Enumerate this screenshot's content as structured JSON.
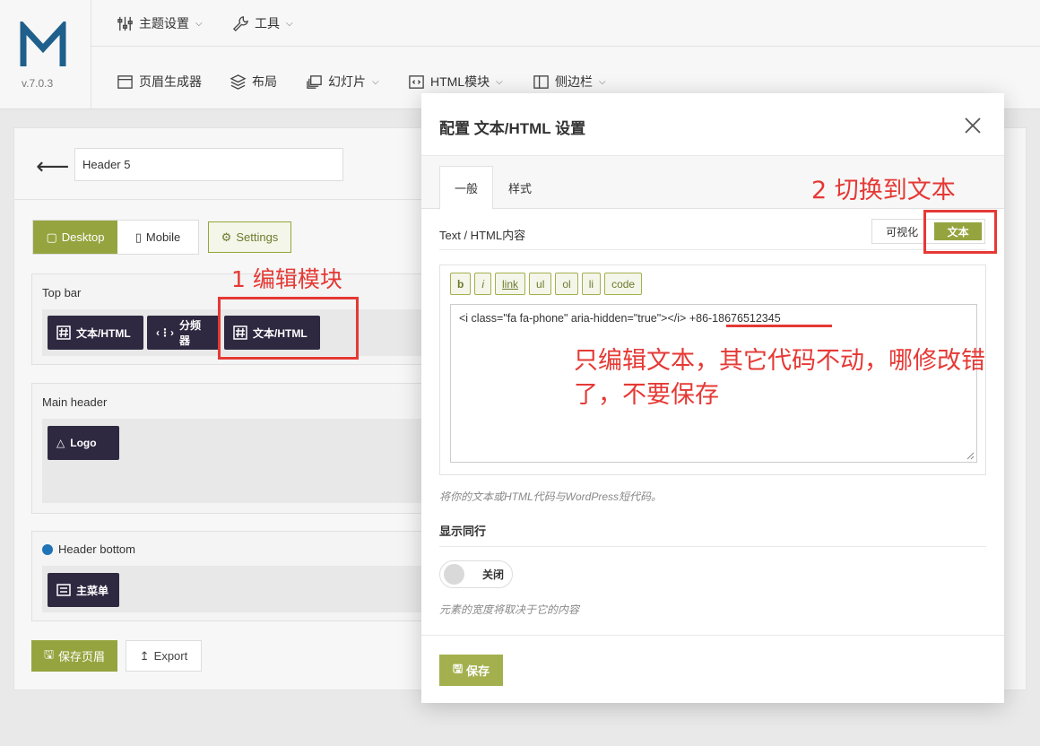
{
  "app": {
    "version": "v.7.0.3",
    "logo_letter": "M"
  },
  "nav": {
    "row1": [
      {
        "label": "主题设置",
        "icon": "sliders-icon",
        "has_dropdown": true
      },
      {
        "label": "工具",
        "icon": "wrench-icon",
        "has_dropdown": true
      }
    ],
    "row2": [
      {
        "label": "页眉生成器",
        "icon": "window-icon",
        "has_dropdown": false
      },
      {
        "label": "布局",
        "icon": "layers-icon",
        "has_dropdown": false
      },
      {
        "label": "幻灯片",
        "icon": "slides-icon",
        "has_dropdown": true
      },
      {
        "label": "HTML模块",
        "icon": "code-icon",
        "has_dropdown": true
      },
      {
        "label": "侧边栏",
        "icon": "sidebar-icon",
        "has_dropdown": true
      }
    ]
  },
  "builder": {
    "header_name": "Header 5",
    "device_desktop": "Desktop",
    "device_mobile": "Mobile",
    "settings_label": "Settings",
    "sections": [
      {
        "title": "Top bar",
        "modules": [
          "文本/HTML",
          "分频器",
          "文本/HTML"
        ]
      },
      {
        "title": "Main header",
        "modules": [
          "Logo"
        ]
      },
      {
        "title": "Header bottom",
        "modules": [
          "主菜单"
        ]
      }
    ],
    "save_label": "保存页眉",
    "export_label": "Export"
  },
  "modal": {
    "title": "配置 文本/HTML 设置",
    "tabs": [
      "一般",
      "样式"
    ],
    "active_tab": "一般",
    "field_label": "Text / HTML内容",
    "editor_mode_visual": "可视化",
    "editor_mode_text": "文本",
    "quicktags": [
      "b",
      "i",
      "link",
      "ul",
      "ol",
      "li",
      "code"
    ],
    "content_code": "<i class=\"fa fa-phone\" aria-hidden=\"true\"></i>",
    "content_text": "+86-18676512345",
    "help_text": "将你的文本或HTML代码与WordPress短代码。",
    "inline_label": "显示同行",
    "inline_state": "关闭",
    "inline_help": "元素的宽度将取决于它的内容",
    "save_label": "保存"
  },
  "annotations": {
    "step1": "1 编辑模块",
    "step2": "2 切换到文本",
    "note": "只编辑文本，其它代码不动，哪修改错了，不要保存",
    "color": "#e53935"
  },
  "colors": {
    "accent": "#95a43e",
    "module_bg": "#2e2840",
    "logo_blue": "#1f5f8b"
  }
}
